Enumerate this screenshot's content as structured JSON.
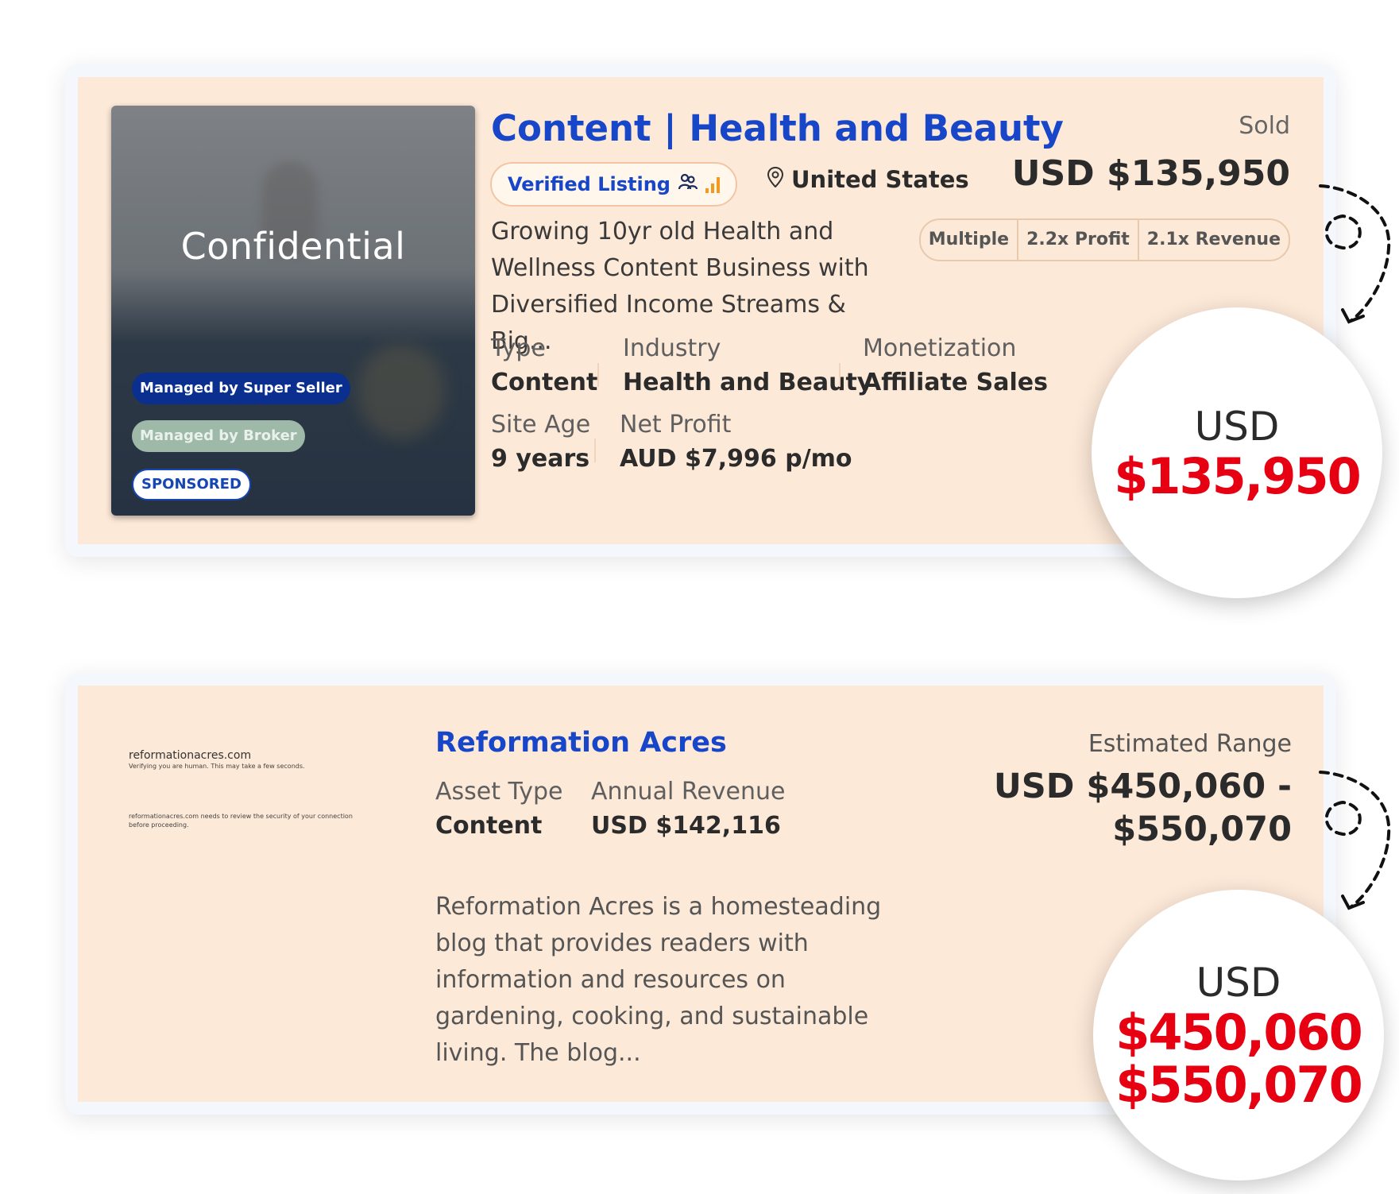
{
  "listing1": {
    "thumbnail_text": "Confidential",
    "badges": {
      "super_seller": "Managed by Super Seller",
      "broker": "Managed by Broker",
      "sponsored": "SPONSORED"
    },
    "title": "Content | Health and Beauty",
    "verified_label": "Verified Listing",
    "location": "United States",
    "status": "Sold",
    "price": "USD $135,950",
    "multiples": {
      "label": "Multiple",
      "profit": "2.2x Profit",
      "revenue": "2.1x Revenue"
    },
    "description": "Growing 10yr old Health and Wellness Content Business with Diversified Income Streams & Big...",
    "metrics": {
      "type_label": "Type",
      "type_value": "Content",
      "industry_label": "Industry",
      "industry_value": "Health and Beauty",
      "monetization_label": "Monetization",
      "monetization_value": "Affiliate Sales",
      "site_age_label": "Site Age",
      "site_age_value": "9 years",
      "net_profit_label": "Net Profit",
      "net_profit_value": "AUD $7,996 p/mo"
    },
    "callout": {
      "currency": "USD",
      "amount": "$135,950"
    }
  },
  "listing2": {
    "screenshot": {
      "domain": "reformationacres.com",
      "line1": "Verifying you are human. This may take a few seconds.",
      "line2": "reformationacres.com needs to review the security of your connection before proceeding."
    },
    "title": "Reformation Acres",
    "metrics": {
      "asset_type_label": "Asset Type",
      "asset_type_value": "Content",
      "annual_revenue_label": "Annual Revenue",
      "annual_revenue_value": "USD $142,116"
    },
    "description": "Reformation Acres is a homesteading blog that provides readers with information and resources on gardening, cooking, and sustainable living. The blog...",
    "estimate_label": "Estimated Range",
    "price_line1": "USD $450,060 -",
    "price_line2": "$550,070",
    "callout": {
      "currency": "USD",
      "amount_low": "$450,060",
      "amount_high": "$550,070"
    }
  },
  "colors": {
    "card_bg": "#fde9d8",
    "title_blue": "#1746c8",
    "callout_red": "#e60012"
  },
  "icons": [
    "location-pin-icon",
    "users-icon",
    "bar-chart-icon",
    "dashed-arrow-icon"
  ]
}
